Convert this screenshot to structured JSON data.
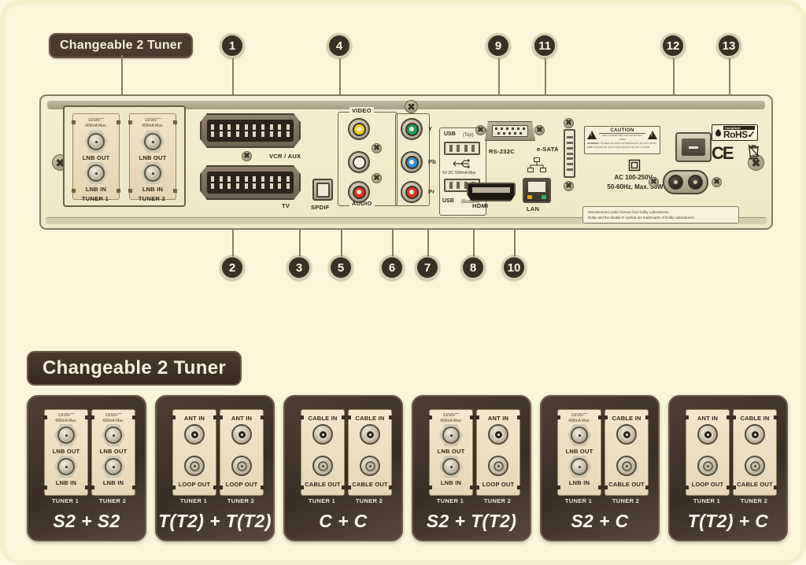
{
  "top_section": {
    "changeable_pill": "Changeable 2 Tuner",
    "callouts_top": [
      {
        "n": "1"
      },
      {
        "n": "4"
      },
      {
        "n": "9"
      },
      {
        "n": "11"
      },
      {
        "n": "12"
      },
      {
        "n": "13"
      }
    ],
    "callouts_bottom": [
      {
        "n": "2"
      },
      {
        "n": "3"
      },
      {
        "n": "5"
      },
      {
        "n": "6"
      },
      {
        "n": "7"
      },
      {
        "n": "8"
      },
      {
        "n": "10"
      }
    ],
    "tuner_bay": {
      "tuner1": {
        "name": "TUNER 1",
        "spec": "13/18V⎓\n400mA Max.",
        "jack_top": "LNB OUT",
        "jack_bottom": "LNB IN"
      },
      "tuner2": {
        "name": "TUNER 2",
        "spec": "13/18V⎓\n400mA Max.",
        "jack_top": "LNB OUT",
        "jack_bottom": "LNB IN"
      }
    },
    "scart_top": "VCR / AUX",
    "scart_bottom": "TV",
    "spdif": "SPDIF",
    "video_group": "VIDEO",
    "audio_group": "AUDIO",
    "component": {
      "y": "Y",
      "pb": "Pb",
      "pr": "Pr"
    },
    "usb_top": "USB",
    "usb_top_sub": "(Top)",
    "usb_bottom": "USB",
    "usb_bottom_sub": "(Bottom)",
    "usb_spec": "5V DC 500mA Max",
    "rs232c": "RS-232C",
    "esata": "e-SATA",
    "hdmi": "HDMI",
    "lan": "LAN",
    "caution_title": "CAUTION",
    "caution_sub": "RISK OF ELECTRIC SHOCK\nDO NOT OPEN",
    "warning_line1": "WARNING: TO REDUCE THE RISK OF FIRE OR ELECTRIC SHOCK DO NOT REMOVE COVER OR BACK",
    "warning_line2": "AVIS: RISQUE DE CHOC ELECTRIQUE NE PAS OUVRIR",
    "ac_spec_line1": "AC 100-250V~",
    "ac_spec_line2": "50-60Hz, Max. 55W",
    "dolby_line1": "Manufactured under license from Dolby Laboratories.",
    "dolby_line2": "Dolby and the double-D symbol are trademarks of Dolby Laboratories.",
    "rohs_compliant": "Compliant",
    "rohs_text": "RoHS",
    "rohs_check": "✓",
    "ce_mark": "CE"
  },
  "bottom_section": {
    "heading": "Changeable 2 Tuner",
    "options": [
      {
        "combo": "S2 + S2",
        "tuners": [
          {
            "name": "TUNER 1",
            "spec": "13/18V⎓\n400mA Max.",
            "top_label": "LNB OUT",
            "bottom_label": "LNB IN",
            "top_type": "f",
            "bottom_type": "f",
            "has_spec": true
          },
          {
            "name": "TUNER 2",
            "spec": "13/18V⎓\n400mA Max.",
            "top_label": "LNB OUT",
            "bottom_label": "LNB IN",
            "top_type": "f",
            "bottom_type": "f",
            "has_spec": true
          }
        ]
      },
      {
        "combo": "T(T2) + T(T2)",
        "tuners": [
          {
            "name": "TUNER 1",
            "spec": "",
            "top_label": "ANT IN",
            "bottom_label": "LOOP OUT",
            "top_type": "c-in",
            "bottom_type": "c-out",
            "has_spec": false
          },
          {
            "name": "TUNER 2",
            "spec": "",
            "top_label": "ANT IN",
            "bottom_label": "LOOP OUT",
            "top_type": "c-in",
            "bottom_type": "c-out",
            "has_spec": false
          }
        ]
      },
      {
        "combo": "C + C",
        "tuners": [
          {
            "name": "TUNER 1",
            "spec": "",
            "top_label": "CABLE IN",
            "bottom_label": "CABLE OUT",
            "top_type": "c-in",
            "bottom_type": "c-out",
            "has_spec": false
          },
          {
            "name": "TUNER 2",
            "spec": "",
            "top_label": "CABLE IN",
            "bottom_label": "CABLE OUT",
            "top_type": "c-in",
            "bottom_type": "c-out",
            "has_spec": false
          }
        ]
      },
      {
        "combo": "S2 + T(T2)",
        "tuners": [
          {
            "name": "TUNER 1",
            "spec": "13/18V⎓\n400mA Max.",
            "top_label": "LNB OUT",
            "bottom_label": "LNB IN",
            "top_type": "f",
            "bottom_type": "f",
            "has_spec": true
          },
          {
            "name": "TUNER 2",
            "spec": "",
            "top_label": "ANT IN",
            "bottom_label": "LOOP OUT",
            "top_type": "c-in",
            "bottom_type": "c-out",
            "has_spec": false
          }
        ]
      },
      {
        "combo": "S2 + C",
        "tuners": [
          {
            "name": "TUNER 1",
            "spec": "13/18V⎓\n400mA Max.",
            "top_label": "LNB OUT",
            "bottom_label": "LNB IN",
            "top_type": "f",
            "bottom_type": "f",
            "has_spec": true
          },
          {
            "name": "TUNER 2",
            "spec": "",
            "top_label": "CABLE IN",
            "bottom_label": "CABLE OUT",
            "top_type": "c-in",
            "bottom_type": "c-out",
            "has_spec": false
          }
        ]
      },
      {
        "combo": "T(T2) + C",
        "tuners": [
          {
            "name": "TUNER 1",
            "spec": "",
            "top_label": "ANT IN",
            "bottom_label": "LOOP OUT",
            "top_type": "c-in",
            "bottom_type": "c-out",
            "has_spec": false
          },
          {
            "name": "TUNER 2",
            "spec": "",
            "top_label": "CABLE IN",
            "bottom_label": "CABLE OUT",
            "top_type": "c-in",
            "bottom_type": "c-out",
            "has_spec": false
          }
        ]
      }
    ]
  },
  "colors": {
    "background": "#fbf6da",
    "panel": "#f2ecd0",
    "dark": "#3a2e22",
    "video_yellow": "#f3d018",
    "audio_white": "#f4f1e4",
    "audio_red": "#e03225",
    "comp_green": "#18a05a",
    "comp_blue": "#2a8fd4",
    "comp_red": "#e03225"
  }
}
